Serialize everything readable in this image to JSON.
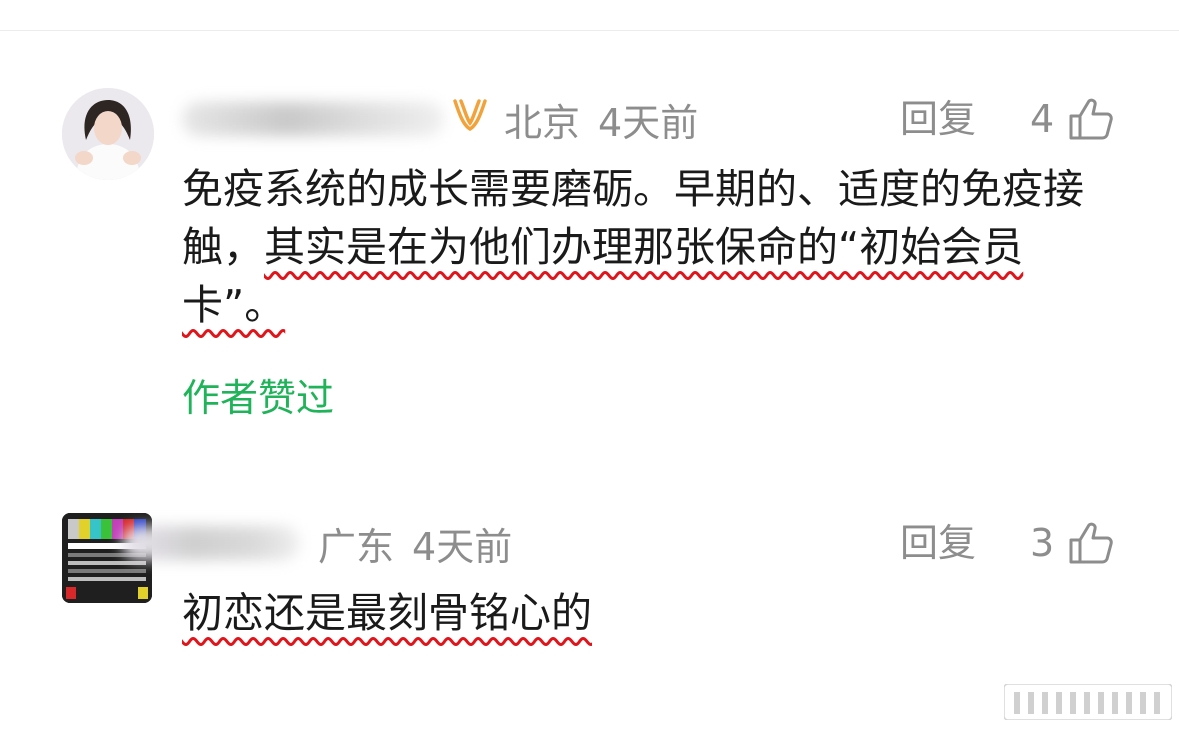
{
  "comments": [
    {
      "location": "北京",
      "time": "4天前",
      "reply_label": "回复",
      "like_count": "4",
      "text_parts": [
        "免疫系统的成长需要磨砺。早期的、适度的免疫接触，",
        "其实是在为他们办理那张保命的“初始会员卡”。"
      ],
      "author_liked": "作者赞过"
    },
    {
      "location": "广东",
      "time": "4天前",
      "reply_label": "回复",
      "like_count": "3",
      "text_parts": [
        "初恋还是最刻骨铭心的"
      ]
    }
  ],
  "colors": {
    "meta_gray": "#8d8d8d",
    "author_liked_green": "#21b35a",
    "wavy_underline_red": "#e0151b",
    "badge_orange": "#f2a23a"
  },
  "icons": {
    "badge": "vip-badge-icon",
    "like": "thumbs-up-icon",
    "bottom": "bar-chart-icon"
  }
}
